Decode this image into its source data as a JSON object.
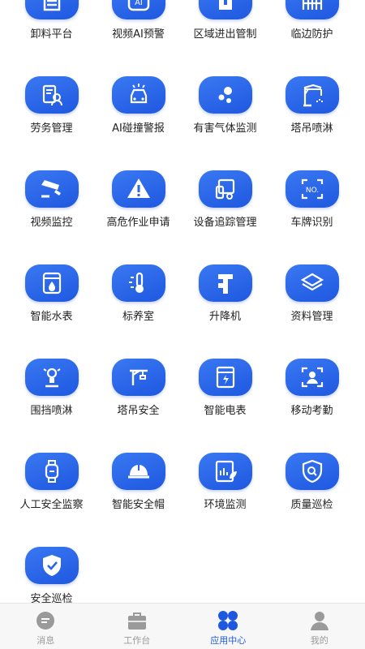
{
  "apps": [
    {
      "label": "卸料平台",
      "icon": "unloading-platform-icon"
    },
    {
      "label": "视频AI预警",
      "icon": "video-ai-icon"
    },
    {
      "label": "区域进出管制",
      "icon": "area-access-icon"
    },
    {
      "label": "临边防护",
      "icon": "edge-protection-icon"
    },
    {
      "label": "劳务管理",
      "icon": "labor-management-icon"
    },
    {
      "label": "AI碰撞警报",
      "icon": "collision-alarm-icon"
    },
    {
      "label": "有害气体监测",
      "icon": "gas-monitor-icon"
    },
    {
      "label": "塔吊喷淋",
      "icon": "tower-crane-spray-icon"
    },
    {
      "label": "视频监控",
      "icon": "cctv-camera-icon"
    },
    {
      "label": "高危作业申请",
      "icon": "warning-triangle-icon"
    },
    {
      "label": "设备追踪管理",
      "icon": "device-tracking-icon"
    },
    {
      "label": "车牌识别",
      "icon": "plate-recognition-icon"
    },
    {
      "label": "智能水表",
      "icon": "water-meter-icon"
    },
    {
      "label": "标养室",
      "icon": "thermometer-icon"
    },
    {
      "label": "升降机",
      "icon": "elevator-icon"
    },
    {
      "label": "资料管理",
      "icon": "layers-icon"
    },
    {
      "label": "围挡喷淋",
      "icon": "fence-spray-icon"
    },
    {
      "label": "塔吊安全",
      "icon": "tower-crane-safety-icon"
    },
    {
      "label": "智能电表",
      "icon": "electric-meter-icon"
    },
    {
      "label": "移动考勤",
      "icon": "face-scan-icon"
    },
    {
      "label": "人工安全监察",
      "icon": "smartwatch-icon"
    },
    {
      "label": "智能安全帽",
      "icon": "helmet-icon"
    },
    {
      "label": "环境监测",
      "icon": "leaf-chart-icon"
    },
    {
      "label": "质量巡检",
      "icon": "shield-search-icon"
    },
    {
      "label": "安全巡检",
      "icon": "shield-check-icon"
    }
  ],
  "tabs": [
    {
      "label": "消息",
      "icon": "message-icon",
      "active": false
    },
    {
      "label": "工作台",
      "icon": "toolbox-icon",
      "active": false
    },
    {
      "label": "应用中心",
      "icon": "app-center-icon",
      "active": true
    },
    {
      "label": "我的",
      "icon": "user-icon",
      "active": false
    }
  ],
  "colors": {
    "accent": "#1e58e0",
    "tab_inactive": "#9a9a9a",
    "tile_light": "#3a78f2"
  }
}
